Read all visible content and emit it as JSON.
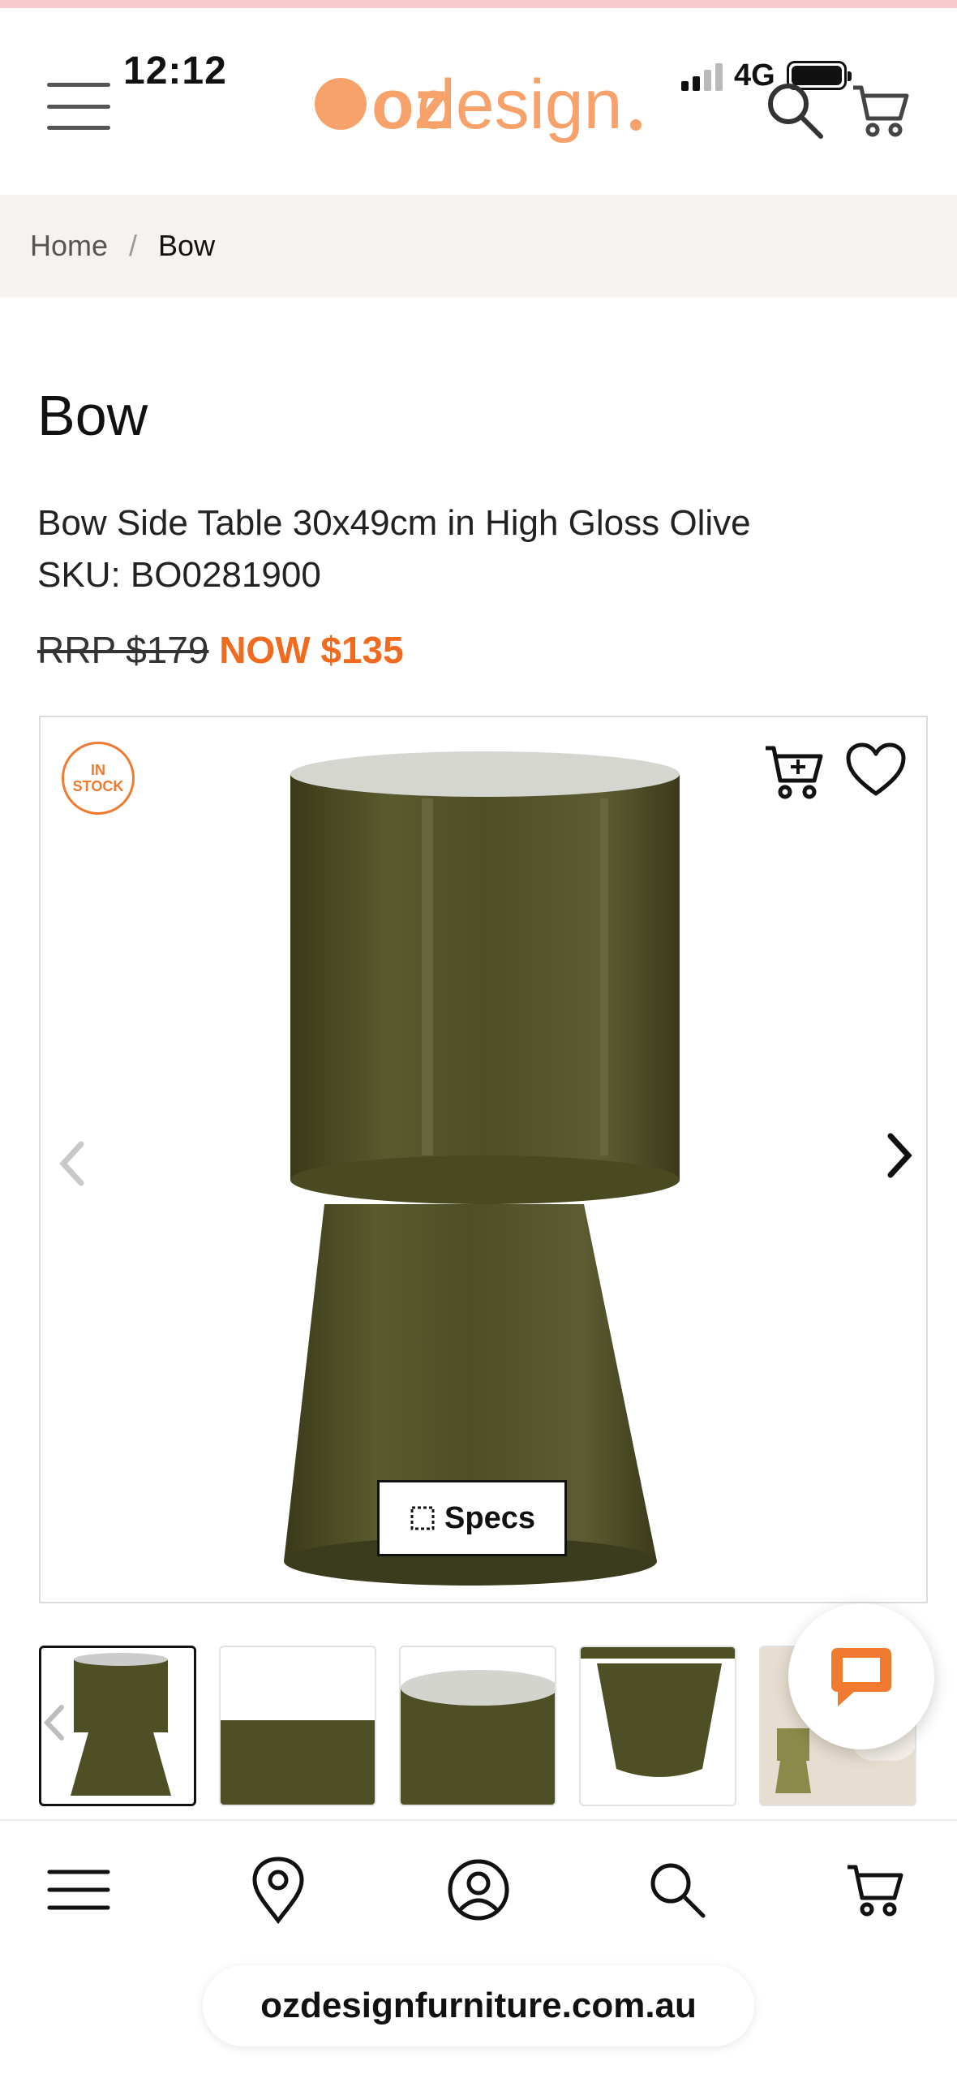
{
  "status": {
    "time": "12:12",
    "network": "4G"
  },
  "header": {
    "logo_prefix": "oz",
    "logo_word": "design",
    "brand_color": "#f7a26b",
    "icons": [
      "menu-icon",
      "search-icon",
      "cart-icon"
    ]
  },
  "breadcrumb": {
    "home": "Home",
    "separator": "/",
    "current": "Bow"
  },
  "product": {
    "title": "Bow",
    "description": "Bow Side Table 30x49cm in High Gloss Olive",
    "sku": "SKU: BO0281900",
    "rrp": "RRP $179",
    "now": "NOW $135",
    "now_color": "#f06a1f",
    "stock_badge": [
      "IN",
      "STOCK"
    ],
    "specs_label": "Specs",
    "product_color": "#4b4a24"
  },
  "thumbnails": [
    "thumb-1",
    "thumb-2",
    "thumb-3",
    "thumb-4",
    "thumb-5"
  ],
  "bottom_nav": {
    "items": [
      "menu-icon",
      "location-icon",
      "account-icon",
      "search-icon",
      "cart-icon"
    ],
    "url": "ozdesignfurniture.com.au"
  }
}
